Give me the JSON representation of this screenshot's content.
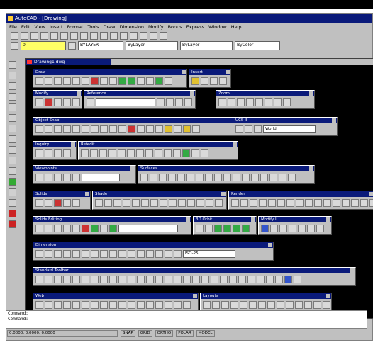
{
  "window": {
    "title": "AutoCAD - [Drawing]"
  },
  "menu": [
    "File",
    "Edit",
    "View",
    "Insert",
    "Format",
    "Tools",
    "Draw",
    "Dimension",
    "Modify",
    "Bonus",
    "Express",
    "Window",
    "Help"
  ],
  "properties": {
    "color": "BYLAYER",
    "layer": "0",
    "linetype": "ByLayer",
    "lineweight": "ByLayer",
    "plot": "ByColor"
  },
  "document": {
    "title": "Drawing1.dwg"
  },
  "panels": {
    "draw": "Draw",
    "insert": "Insert",
    "modify": "Modify",
    "reference": "Reference",
    "zoom": "Zoom",
    "object_snap": "Object Snap",
    "ucs": "UCS II",
    "ucs_field": "World",
    "inquiry": "Inquiry",
    "refedit": "Refedit",
    "viewpoints": "Viewpoints",
    "surfaces": "Surfaces",
    "solids": "Solids",
    "shade": "Shade",
    "render": "Render",
    "solids_editing": "Solids Editing",
    "3d_orbit": "3D Orbit",
    "modify_ii": "Modify II",
    "web": "Web",
    "dimension": "Dimension",
    "dim_field": "ISO-25",
    "standard": "Standard Toolbar",
    "layouts": "Layouts"
  },
  "command": {
    "line1": "Command:",
    "line2": "Command:"
  },
  "status": {
    "coords": "0.0000, 0.0000, 0.0000",
    "snap": "SNAP",
    "grid": "GRID",
    "ortho": "ORTHO",
    "polar": "POLAR",
    "model": "MODEL"
  }
}
